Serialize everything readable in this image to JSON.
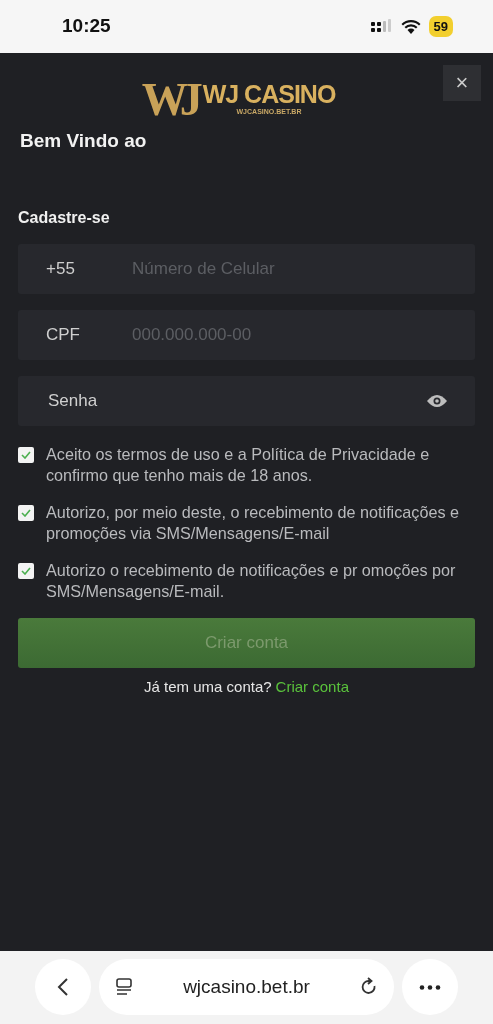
{
  "status_bar": {
    "time": "10:25",
    "battery": "59"
  },
  "header": {
    "monogram": "WJ",
    "brand": "WJ CASINO",
    "domain": "WJCASINO.BET.BR",
    "close": "×"
  },
  "welcome": "Bem Vindo ao",
  "form": {
    "title": "Cadastre-se",
    "fields": [
      {
        "prefix": "+55",
        "placeholder": "Número de Celular"
      },
      {
        "prefix": "CPF",
        "placeholder": "000.000.000-00"
      },
      {
        "placeholder": "Senha",
        "kind": "password"
      }
    ],
    "consents": [
      {
        "text": "Aceito os termos de uso e a Política de Privacidade e confirmo que tenho mais de 18 anos.",
        "checked": true
      },
      {
        "text": "Autorizo, por meio deste, o recebimento de notificações e promoções via SMS/Mensagens/E-mail",
        "checked": true
      },
      {
        "text": "Autorizo o recebimento de notificações e pr omoções por SMS/Mensagens/E-mail.",
        "checked": true
      }
    ],
    "submit": {
      "label": "Criar conta",
      "disabled": true
    },
    "login_prompt": "Já tem uma conta?",
    "login_link": "Criar conta"
  },
  "browser": {
    "url": "wjcasino.bet.br"
  }
}
